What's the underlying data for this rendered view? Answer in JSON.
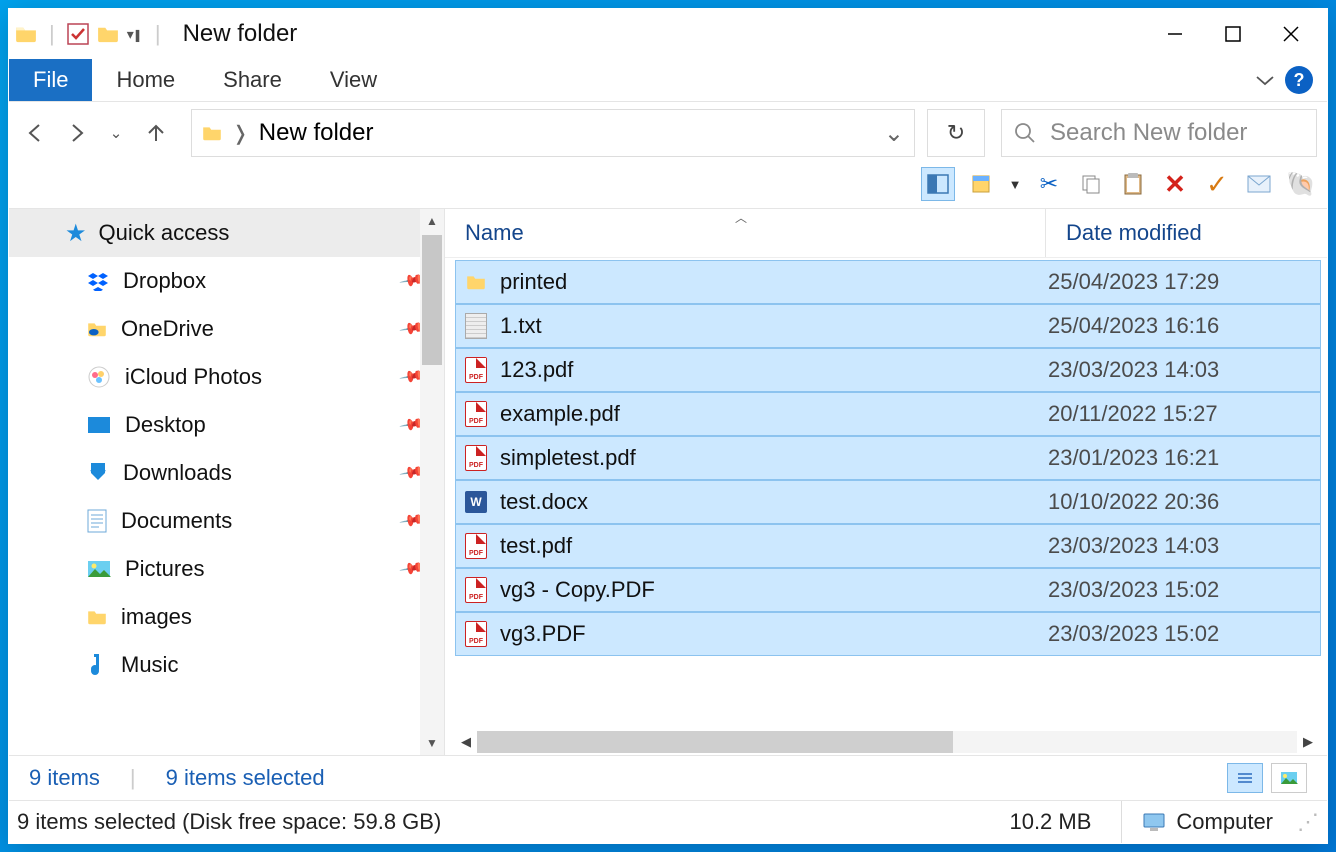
{
  "window_title": "New folder",
  "tabs": {
    "file": "File",
    "home": "Home",
    "share": "Share",
    "view": "View"
  },
  "breadcrumb": {
    "current": "New folder"
  },
  "search_placeholder": "Search New folder",
  "columns": {
    "name": "Name",
    "date": "Date modified"
  },
  "sidebar": {
    "quick_access": "Quick access",
    "items": [
      {
        "label": "Dropbox",
        "pinned": true,
        "icon": "dropbox"
      },
      {
        "label": "OneDrive",
        "pinned": true,
        "icon": "onedrive"
      },
      {
        "label": "iCloud Photos",
        "pinned": true,
        "icon": "icloud"
      },
      {
        "label": "Desktop",
        "pinned": true,
        "icon": "desktop"
      },
      {
        "label": "Downloads",
        "pinned": true,
        "icon": "downloads"
      },
      {
        "label": "Documents",
        "pinned": true,
        "icon": "documents"
      },
      {
        "label": "Pictures",
        "pinned": true,
        "icon": "pictures"
      },
      {
        "label": "images",
        "pinned": false,
        "icon": "folder"
      },
      {
        "label": "Music",
        "pinned": false,
        "icon": "music"
      }
    ]
  },
  "files": [
    {
      "name": "printed",
      "date": "25/04/2023 17:29",
      "type": "folder"
    },
    {
      "name": "1.txt",
      "date": "25/04/2023 16:16",
      "type": "txt"
    },
    {
      "name": "123.pdf",
      "date": "23/03/2023 14:03",
      "type": "pdf"
    },
    {
      "name": "example.pdf",
      "date": "20/11/2022 15:27",
      "type": "pdf"
    },
    {
      "name": "simpletest.pdf",
      "date": "23/01/2023 16:21",
      "type": "pdf"
    },
    {
      "name": "test.docx",
      "date": "10/10/2022 20:36",
      "type": "docx"
    },
    {
      "name": "test.pdf",
      "date": "23/03/2023 14:03",
      "type": "pdf"
    },
    {
      "name": "vg3 - Copy.PDF",
      "date": "23/03/2023 15:02",
      "type": "pdf"
    },
    {
      "name": "vg3.PDF",
      "date": "23/03/2023 15:02",
      "type": "pdf"
    }
  ],
  "status": {
    "count": "9 items",
    "selected": "9 items selected"
  },
  "footer": {
    "text": "9 items selected (Disk free space: 59.8 GB)",
    "size": "10.2 MB",
    "location": "Computer"
  }
}
